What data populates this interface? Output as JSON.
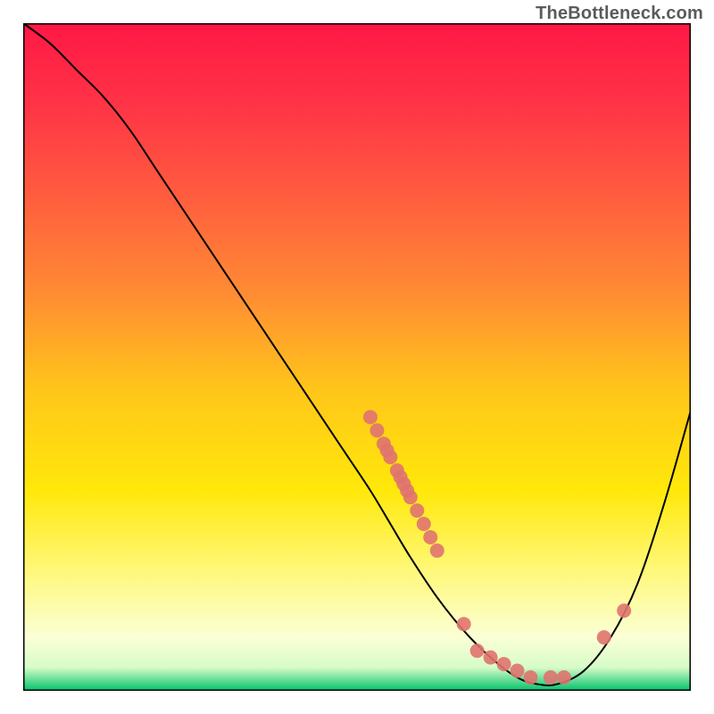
{
  "watermark": "TheBottleneck.com",
  "chart_data": {
    "type": "line",
    "title": "",
    "xlabel": "",
    "ylabel": "",
    "xlim": [
      0,
      100
    ],
    "ylim": [
      0,
      100
    ],
    "grid": false,
    "background_gradient": {
      "stops": [
        {
          "offset": 0.0,
          "color": "#ff1846"
        },
        {
          "offset": 0.12,
          "color": "#ff3346"
        },
        {
          "offset": 0.25,
          "color": "#ff5a3f"
        },
        {
          "offset": 0.4,
          "color": "#ff8a34"
        },
        {
          "offset": 0.55,
          "color": "#ffc61a"
        },
        {
          "offset": 0.7,
          "color": "#ffe80a"
        },
        {
          "offset": 0.82,
          "color": "#fff87a"
        },
        {
          "offset": 0.92,
          "color": "#fbffd5"
        },
        {
          "offset": 0.965,
          "color": "#d7fcc8"
        },
        {
          "offset": 1.0,
          "color": "#00c26b"
        }
      ]
    },
    "series": [
      {
        "name": "curve",
        "color": "#000000",
        "linewidth": 2,
        "x": [
          0,
          4,
          8,
          12,
          16,
          20,
          24,
          28,
          32,
          36,
          40,
          44,
          48,
          52,
          55,
          58,
          62,
          66,
          70,
          74,
          77,
          80,
          84,
          88,
          92,
          96,
          100
        ],
        "y": [
          100,
          97,
          93,
          89,
          84,
          78,
          72,
          66,
          60,
          54,
          48,
          42,
          36,
          30,
          25,
          20,
          14,
          9,
          5,
          2,
          1,
          1,
          3,
          8,
          16,
          28,
          42
        ]
      }
    ],
    "markers": [
      {
        "name": "points-on-curve",
        "color": "#e0736f",
        "r": 8,
        "points": [
          {
            "x": 52,
            "y": 41
          },
          {
            "x": 53,
            "y": 39
          },
          {
            "x": 54,
            "y": 37
          },
          {
            "x": 54.5,
            "y": 36
          },
          {
            "x": 55,
            "y": 35
          },
          {
            "x": 56,
            "y": 33
          },
          {
            "x": 56.5,
            "y": 32
          },
          {
            "x": 57,
            "y": 31
          },
          {
            "x": 57.5,
            "y": 30
          },
          {
            "x": 58,
            "y": 29
          },
          {
            "x": 59,
            "y": 27
          },
          {
            "x": 60,
            "y": 25
          },
          {
            "x": 61,
            "y": 23
          },
          {
            "x": 62,
            "y": 21
          },
          {
            "x": 66,
            "y": 10
          },
          {
            "x": 68,
            "y": 6
          },
          {
            "x": 70,
            "y": 5
          },
          {
            "x": 72,
            "y": 4
          },
          {
            "x": 74,
            "y": 3
          },
          {
            "x": 76,
            "y": 2
          },
          {
            "x": 79,
            "y": 2
          },
          {
            "x": 81,
            "y": 2
          },
          {
            "x": 87,
            "y": 8
          },
          {
            "x": 90,
            "y": 12
          }
        ]
      }
    ]
  }
}
